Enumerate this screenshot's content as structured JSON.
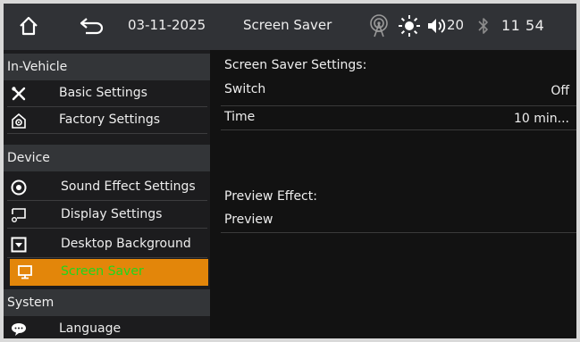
{
  "topbar": {
    "home_icon": "home-icon",
    "back_icon": "back-arrow-icon",
    "date": "03-11-2025",
    "title": "Screen Saver",
    "signal_icon": "signal-tower-icon",
    "brightness_icon": "sun-icon",
    "volume_icon": "speaker-icon",
    "volume": "20",
    "bluetooth_icon": "bluetooth-icon",
    "time": "11 54"
  },
  "sidebar": {
    "sections": {
      "in_vehicle": "In-Vehicle",
      "device": "Device",
      "system": "System"
    },
    "items": {
      "basic": {
        "label": "Basic Settings",
        "icon": "tools-icon"
      },
      "factory": {
        "label": "Factory Settings",
        "icon": "factory-icon"
      },
      "sound": {
        "label": "Sound Effect Settings",
        "icon": "speaker-circle-icon"
      },
      "display": {
        "label": "Display Settings",
        "icon": "display-icon"
      },
      "desktop": {
        "label": "Desktop Background",
        "icon": "image-icon"
      },
      "screensaver": {
        "label": "Screen Saver",
        "icon": "monitor-icon"
      },
      "language": {
        "label": "Language",
        "icon": "speech-bubble-icon"
      }
    }
  },
  "content": {
    "settings_heading": "Screen Saver Settings:",
    "switch_label": "Switch",
    "switch_value": "Off",
    "time_label": "Time",
    "time_value": "10 min...",
    "preview_heading": "Preview Effect:",
    "preview_label": "Preview"
  },
  "colors": {
    "active_bg": "#e3860a",
    "active_text": "#1ed81e",
    "topbar_bg": "#303236"
  }
}
